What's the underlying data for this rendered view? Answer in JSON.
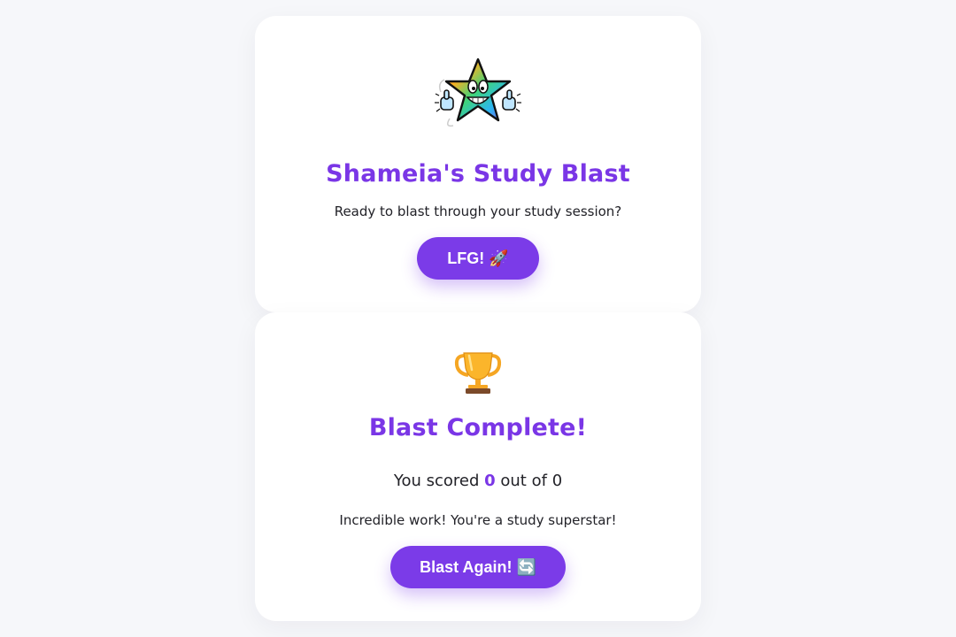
{
  "start": {
    "mascot_icon": "rainbow-star-thumbs-up-icon",
    "title": "Shameia's Study Blast",
    "subtitle": "Ready to blast through your study session?",
    "button_label": "LFG! 🚀"
  },
  "result": {
    "trophy_icon": "trophy-icon",
    "title": "Blast Complete!",
    "score_prefix": "You scored",
    "score_value": "0",
    "score_middle": "out of",
    "score_total": "0",
    "message": "Incredible work! You're a study superstar!",
    "button_label": "Blast Again! 🔄"
  },
  "colors": {
    "accent": "#7b3be8",
    "title": "#7a36e6",
    "background": "#f6f7fa",
    "card": "#ffffff"
  }
}
